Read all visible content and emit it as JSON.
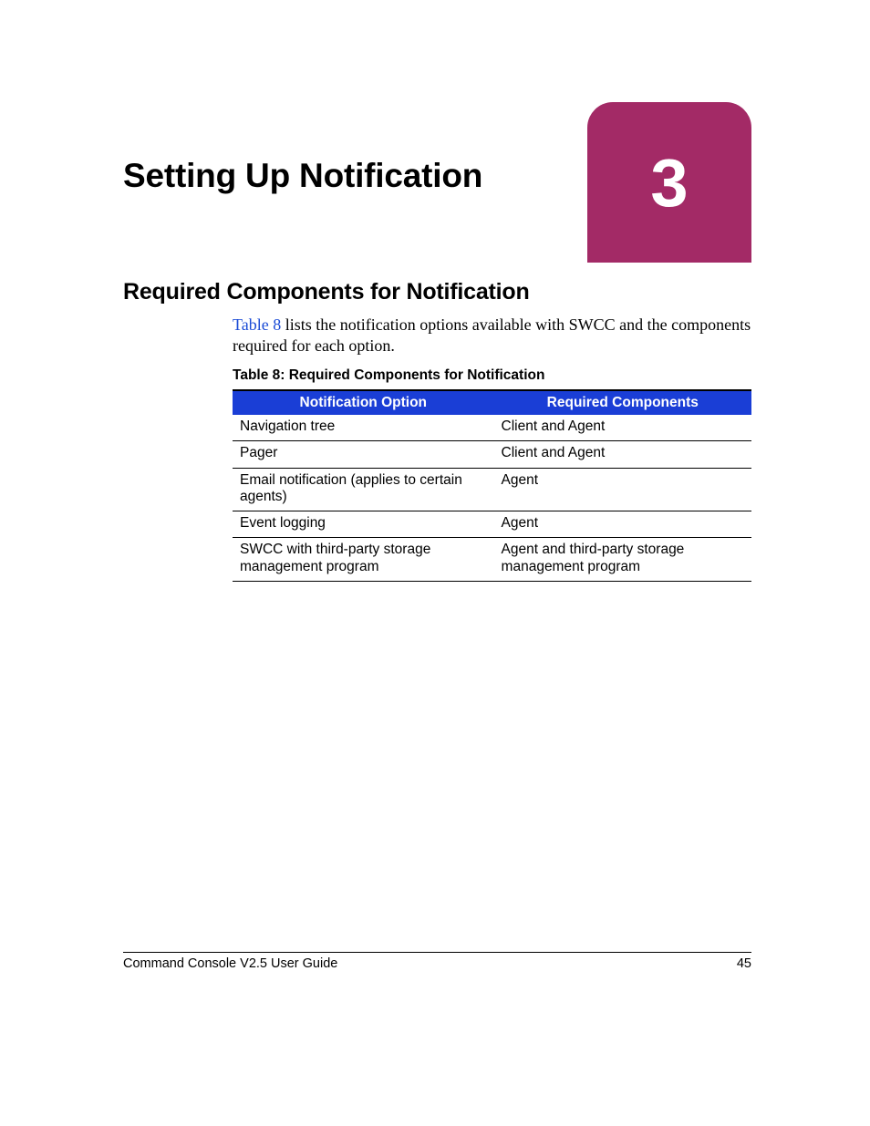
{
  "chapter": {
    "title": "Setting Up Notification",
    "number": "3"
  },
  "section": {
    "title": "Required Components for Notification"
  },
  "intro": {
    "xref": "Table 8",
    "rest": " lists the notification options available with SWCC and the components required for each option."
  },
  "table": {
    "caption": "Table 8:  Required Components for Notification",
    "headers": [
      "Notification Option",
      "Required Components"
    ],
    "rows": [
      [
        "Navigation tree",
        "Client and Agent"
      ],
      [
        "Pager",
        "Client and Agent"
      ],
      [
        "Email notification (applies to certain agents)",
        "Agent"
      ],
      [
        "Event logging",
        "Agent"
      ],
      [
        "SWCC with third-party storage management program",
        "Agent and third-party storage management program"
      ]
    ]
  },
  "footer": {
    "left": "Command Console V2.5 User Guide",
    "right": "45"
  }
}
